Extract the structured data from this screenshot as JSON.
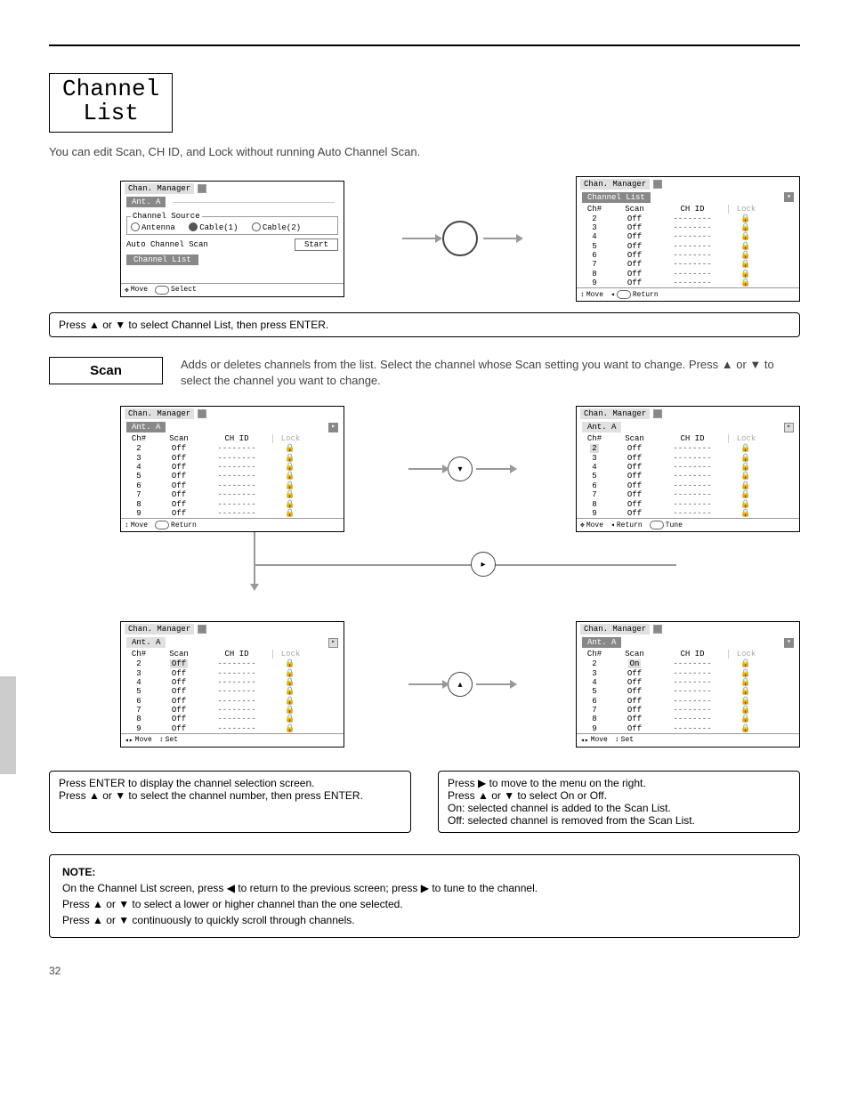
{
  "section_title_line1": "Channel",
  "section_title_line2": "List",
  "intro": "You can edit Scan, CH ID, and Lock without running Auto Channel Scan.",
  "menu_title": "Chan. Manager",
  "ant_label": "Ant. A",
  "channel_source_legend": "Channel Source",
  "src_antenna": "Antenna",
  "src_cable1": "Cable(1)",
  "src_cable2": "Cable(2)",
  "auto_scan_label": "Auto Channel Scan",
  "start_label": "Start",
  "channel_list_label": "Channel List",
  "footer_move": "Move",
  "footer_select": "Select",
  "footer_return": "Return",
  "footer_tune": "Tune",
  "footer_set": "Set",
  "col_ch": "Ch#",
  "col_scan": "Scan",
  "col_chid": "CH ID",
  "col_lock": "Lock",
  "rows": [
    {
      "ch": "2",
      "scan": "Off",
      "id": "--------"
    },
    {
      "ch": "3",
      "scan": "Off",
      "id": "--------"
    },
    {
      "ch": "4",
      "scan": "Off",
      "id": "--------"
    },
    {
      "ch": "5",
      "scan": "Off",
      "id": "--------"
    },
    {
      "ch": "6",
      "scan": "Off",
      "id": "--------"
    },
    {
      "ch": "7",
      "scan": "Off",
      "id": "--------"
    },
    {
      "ch": "8",
      "scan": "Off",
      "id": "--------"
    },
    {
      "ch": "9",
      "scan": "Off",
      "id": "--------"
    }
  ],
  "rows_on": [
    {
      "ch": "2",
      "scan": "On",
      "id": "--------"
    },
    {
      "ch": "3",
      "scan": "Off",
      "id": "--------"
    },
    {
      "ch": "4",
      "scan": "Off",
      "id": "--------"
    },
    {
      "ch": "5",
      "scan": "Off",
      "id": "--------"
    },
    {
      "ch": "6",
      "scan": "Off",
      "id": "--------"
    },
    {
      "ch": "7",
      "scan": "Off",
      "id": "--------"
    },
    {
      "ch": "8",
      "scan": "Off",
      "id": "--------"
    },
    {
      "ch": "9",
      "scan": "Off",
      "id": "--------"
    }
  ],
  "caption1": "Press ▲ or ▼ to select Channel List, then press ENTER.",
  "scan_step_label": "Scan",
  "scan_step_text": "Adds or deletes channels from the list. Select the channel whose Scan setting you want to change. Press ▲ or ▼ to select the channel you want to change.",
  "caption2_a": "Press ENTER to display the channel selection screen.",
  "caption2_b": "Press ▲ or ▼ to select the channel number, then press ENTER.",
  "caption3_a": "Press ▶ to move to the menu on the right.",
  "caption3_b": "Press ▲ or ▼ to select On or Off.",
  "caption3_c": "On: selected channel is added to the Scan List.",
  "caption3_d": "Off: selected channel is removed from the Scan List.",
  "note_title": "NOTE:",
  "note_line1": "On the Channel List screen, press ◀ to return to the previous screen; press ▶ to tune to the channel.",
  "note_line2": "Press ▲ or ▼ to select a lower or higher channel than the one selected.",
  "note_line3": "Press ▲ or ▼ continuously to quickly scroll through channels.",
  "page_number": "32"
}
